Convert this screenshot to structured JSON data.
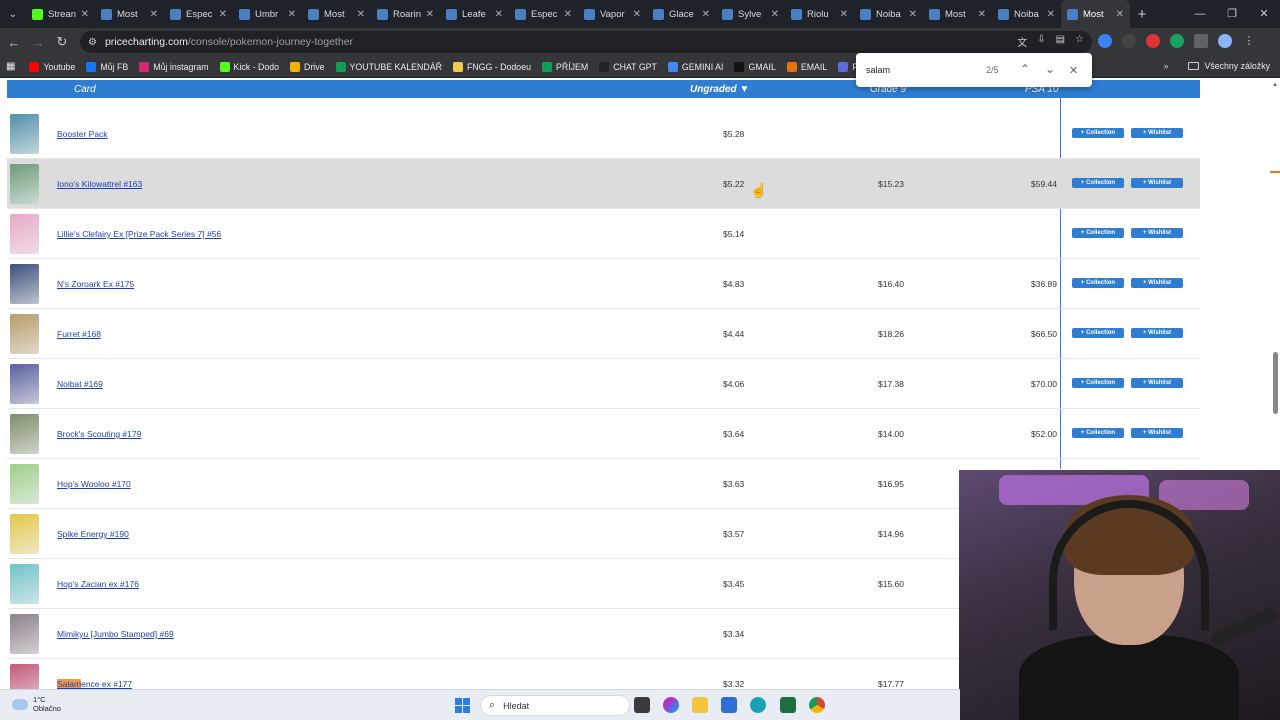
{
  "browser": {
    "tabs": [
      {
        "title": "Strean",
        "favicon_color": "#53fc18"
      },
      {
        "title": "Most",
        "favicon_color": "#4a7fc1"
      },
      {
        "title": "Espec",
        "favicon_color": "#4a7fc1"
      },
      {
        "title": "Umbr",
        "favicon_color": "#4a7fc1"
      },
      {
        "title": "Most",
        "favicon_color": "#4a7fc1"
      },
      {
        "title": "Roarin",
        "favicon_color": "#4a7fc1"
      },
      {
        "title": "Leafe",
        "favicon_color": "#4a7fc1"
      },
      {
        "title": "Espec",
        "favicon_color": "#4a7fc1"
      },
      {
        "title": "Vapor",
        "favicon_color": "#4a7fc1"
      },
      {
        "title": "Glace",
        "favicon_color": "#4a7fc1"
      },
      {
        "title": "Sylve",
        "favicon_color": "#4a7fc1"
      },
      {
        "title": "Riolu",
        "favicon_color": "#4a7fc1"
      },
      {
        "title": "Noiba",
        "favicon_color": "#4a7fc1"
      },
      {
        "title": "Most",
        "favicon_color": "#4a7fc1"
      },
      {
        "title": "Noiba",
        "favicon_color": "#4a7fc1"
      },
      {
        "title": "Most",
        "favicon_color": "#4a7fc1",
        "active": true
      }
    ],
    "url_domain": "pricecharting.com",
    "url_path": "/console/pokemon-journey-together",
    "bookmarks": [
      {
        "label": "Youtube",
        "color": "#ff0000"
      },
      {
        "label": "Můj FB",
        "color": "#1877f2"
      },
      {
        "label": "Můj instagram",
        "color": "#d62976"
      },
      {
        "label": "Kick - Dodo",
        "color": "#53fc18"
      },
      {
        "label": "Drive",
        "color": "#f4b400"
      },
      {
        "label": "YOUTUBE KALENDÁŘ",
        "color": "#0f9d58"
      },
      {
        "label": "FNGG - Dodoeu",
        "color": "#f2c94c"
      },
      {
        "label": "PŘÍJEM",
        "color": "#0f9d58"
      },
      {
        "label": "CHAT GPT",
        "color": "#202124"
      },
      {
        "label": "GEMINI AI",
        "color": "#4285f4"
      },
      {
        "label": "GMAIL",
        "color": "#111111"
      },
      {
        "label": "EMAIL",
        "color": "#e8710a"
      },
      {
        "label": "Faktury -",
        "color": "#5f6ad4"
      }
    ],
    "bookmarks_folder": "Všechny záložky"
  },
  "find_bar": {
    "query": "salam",
    "count": "2/5"
  },
  "table": {
    "headers": {
      "card": "Card",
      "ungraded": "Ungraded ▼",
      "grade9": "Grade 9",
      "psa10": "PSA 10"
    },
    "collection_label": "+ Collection",
    "wishlist_label": "+ Wishlist",
    "rows": [
      {
        "name": "Booster Pack",
        "ungraded": "$5.28",
        "grade9": "",
        "psa10": "",
        "thumb": "#4f8fa8"
      },
      {
        "name": "Iono's Kilowattrel #163",
        "ungraded": "$5.22",
        "grade9": "$15.23",
        "psa10": "$59.44",
        "thumb": "#6a9c7a",
        "highlight": true
      },
      {
        "name": "Lillie's Clefairy Ex [Prize Pack Series 7] #56",
        "ungraded": "$5.14",
        "grade9": "",
        "psa10": "",
        "thumb": "#e9a7c6"
      },
      {
        "name": "N's Zoroark Ex #175",
        "ungraded": "$4.83",
        "grade9": "$16.40",
        "psa10": "$36.89",
        "thumb": "#3b4f7a"
      },
      {
        "name": "Furret #168",
        "ungraded": "$4.44",
        "grade9": "$18.26",
        "psa10": "$66.50",
        "thumb": "#b79b6a"
      },
      {
        "name": "Noibat #169",
        "ungraded": "$4.06",
        "grade9": "$17.38",
        "psa10": "$70.00",
        "thumb": "#5a5f9e"
      },
      {
        "name": "Brock's Scouting #179",
        "ungraded": "$3.64",
        "grade9": "$14.00",
        "psa10": "$52.00",
        "thumb": "#7c8d69"
      },
      {
        "name": "Hop's Wooloo #170",
        "ungraded": "$3.63",
        "grade9": "$16.95",
        "psa10": "",
        "thumb": "#9dcf8a"
      },
      {
        "name": "Spike Energy #190",
        "ungraded": "$3.57",
        "grade9": "$14.96",
        "psa10": "",
        "thumb": "#e4c84a"
      },
      {
        "name": "Hop's Zacian ex #176",
        "ungraded": "$3.45",
        "grade9": "$15.60",
        "psa10": "",
        "thumb": "#6fc3c9"
      },
      {
        "name": "Mimikyu [Jumbo Stamped] #69",
        "ungraded": "$3.34",
        "grade9": "",
        "psa10": "",
        "thumb": "#8c7f8a"
      },
      {
        "name_mark": "Salam",
        "name_rest": "ence ex #177",
        "ungraded": "$3.32",
        "grade9": "$17.77",
        "psa10": "",
        "thumb": "#c45a7a"
      }
    ]
  },
  "taskbar": {
    "temp": "1°C",
    "weather": "Oblačno",
    "search_placeholder": "Hledat"
  }
}
